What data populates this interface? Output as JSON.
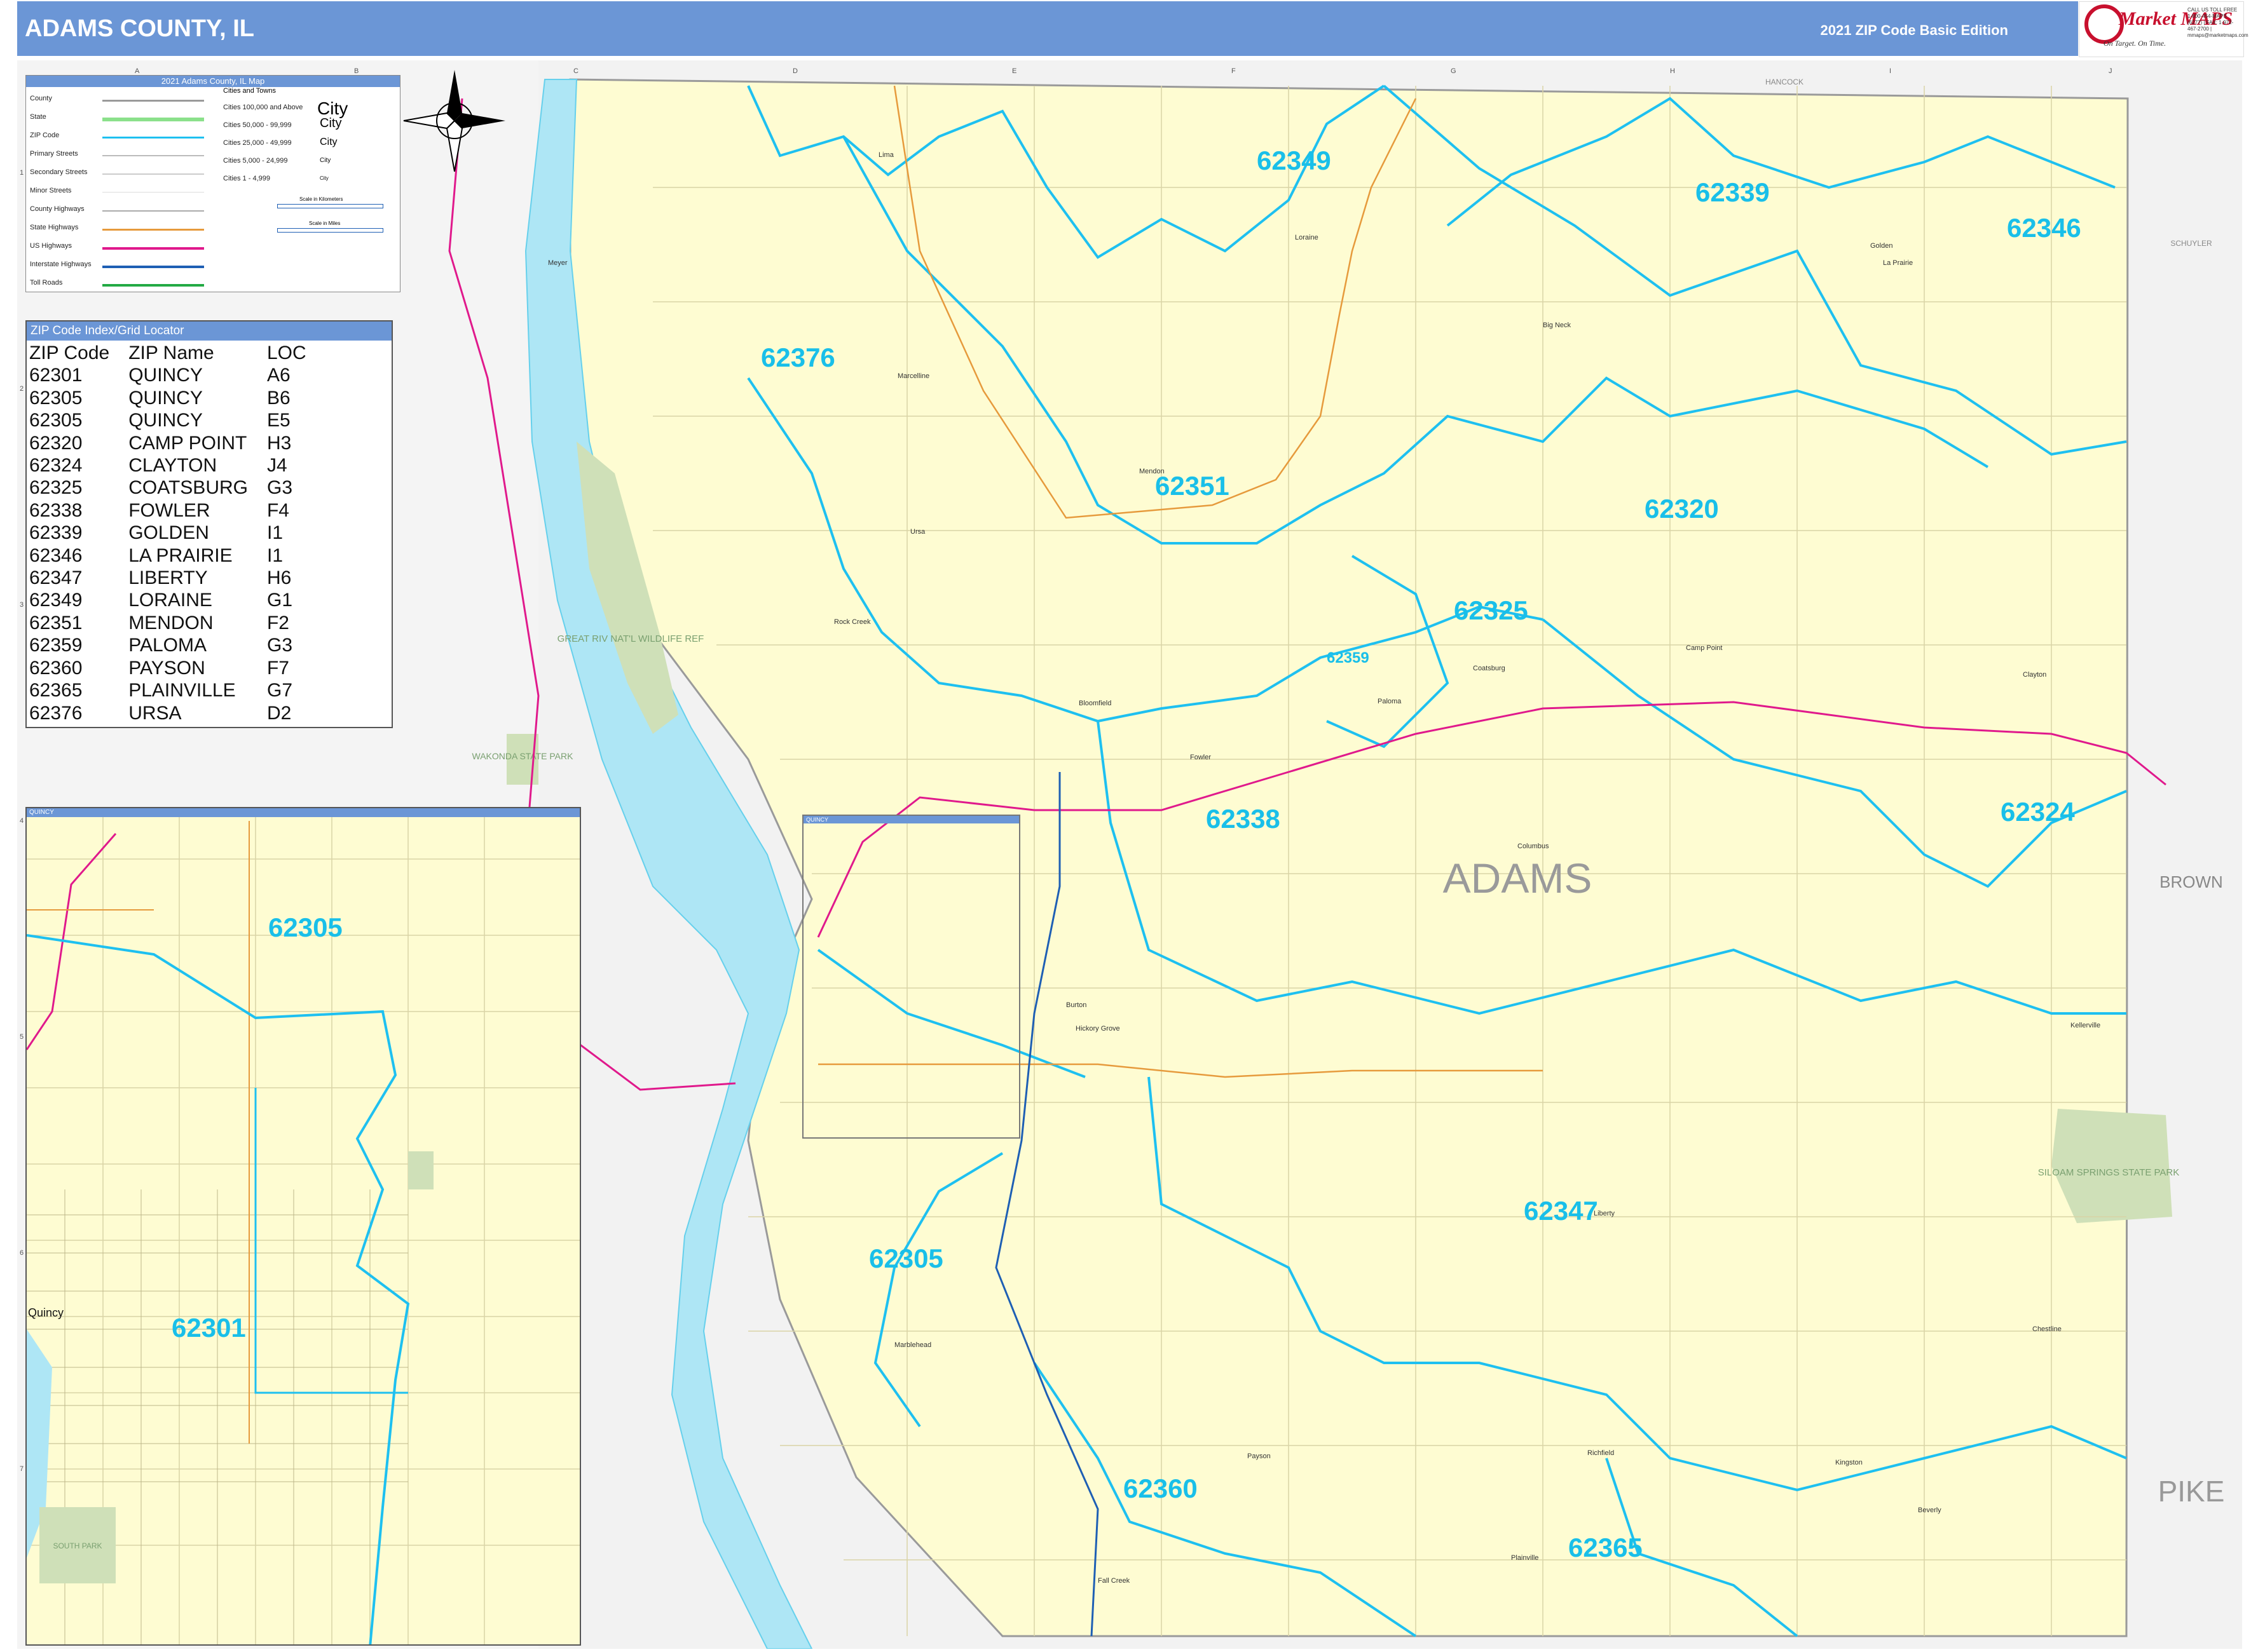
{
  "header": {
    "title": "ADAMS COUNTY, IL",
    "edition": "2021 ZIP Code Basic Edition"
  },
  "brand": {
    "name": "Market MAPS",
    "tagline": "On Target. On Time.",
    "subtitle": "America's Leading Source of Reference Maps",
    "contact": "CALL US TOLL FREE 1-800-454-MAPS (6277) | FAX: 1-972-467-2700 | mmaps@marketmaps.com"
  },
  "legend": {
    "title": "2021 Adams County, IL Map",
    "cities_heading": "Cities and Towns",
    "rows": [
      {
        "label": "County",
        "color": "#9a9a9a"
      },
      {
        "label": "State",
        "color": "#8be08b"
      },
      {
        "label": "ZIP Code",
        "color": "#1ec0f0"
      },
      {
        "label": "Primary Streets",
        "color": "#bbbbbb"
      },
      {
        "label": "Secondary Streets",
        "color": "#cccccc"
      },
      {
        "label": "Minor Streets",
        "color": "#dddddd"
      },
      {
        "label": "County Highways",
        "color": "#aaaaaa"
      },
      {
        "label": "State Highways",
        "color": "#e69a3c"
      },
      {
        "label": "US Highways",
        "color": "#e0198c"
      },
      {
        "label": "Interstate Highways",
        "color": "#1e5fb4"
      },
      {
        "label": "Toll Roads",
        "color": "#22aa44"
      }
    ],
    "city_classes": [
      {
        "label": "Cities 100,000 and Above",
        "sample": "City"
      },
      {
        "label": "Cities 50,000 - 99,999",
        "sample": "City"
      },
      {
        "label": "Cities 25,000 - 49,999",
        "sample": "City"
      },
      {
        "label": "Cities 5,000 - 24,999",
        "sample": "City"
      },
      {
        "label": "Cities 1 - 4,999",
        "sample": "City"
      }
    ],
    "scale_km": "Scale in Kilometers",
    "scale_mi": "Scale in Miles"
  },
  "zip_index": {
    "title": "ZIP Code Index/Grid Locator",
    "columns": [
      "ZIP Code",
      "ZIP Name",
      "LOC"
    ],
    "rows": [
      [
        "62301",
        "QUINCY",
        "A6"
      ],
      [
        "62305",
        "QUINCY",
        "B6"
      ],
      [
        "62305",
        "QUINCY",
        "E5"
      ],
      [
        "62320",
        "CAMP POINT",
        "H3"
      ],
      [
        "62324",
        "CLAYTON",
        "J4"
      ],
      [
        "62325",
        "COATSBURG",
        "G3"
      ],
      [
        "62338",
        "FOWLER",
        "F4"
      ],
      [
        "62339",
        "GOLDEN",
        "I1"
      ],
      [
        "62346",
        "LA PRAIRIE",
        "I1"
      ],
      [
        "62347",
        "LIBERTY",
        "H6"
      ],
      [
        "62349",
        "LORAINE",
        "G1"
      ],
      [
        "62351",
        "MENDON",
        "F2"
      ],
      [
        "62359",
        "PALOMA",
        "G3"
      ],
      [
        "62360",
        "PAYSON",
        "F7"
      ],
      [
        "62365",
        "PLAINVILLE",
        "G7"
      ],
      [
        "62376",
        "URSA",
        "D2"
      ]
    ]
  },
  "map": {
    "county_label": "ADAMS",
    "neighbors": [
      "BROWN",
      "PIKE",
      "HANCOCK",
      "SCHUYLER"
    ],
    "zip_labels": [
      "62349",
      "62339",
      "62346",
      "62376",
      "62351",
      "62320",
      "62325",
      "62359",
      "62338",
      "62324",
      "62305",
      "62347",
      "62360",
      "62365"
    ],
    "parks": [
      {
        "name": "GREAT RIV NAT'L WILDLIFE REF"
      },
      {
        "name": "WAKONDA STATE PARK"
      },
      {
        "name": "SILOAM SPRINGS STATE PARK"
      }
    ],
    "towns": [
      "Meyer",
      "Lima",
      "Ursa",
      "Loraine",
      "Golden",
      "La Prairie",
      "Mendon",
      "Coatsburg",
      "Camp Point",
      "Clayton",
      "Paloma",
      "Fowler",
      "Columbus",
      "Marcelline",
      "Rock Creek",
      "Bloomfield",
      "Kellerville",
      "Liberty",
      "Plainville",
      "Payson",
      "Fall Creek",
      "Richfield",
      "Kingston",
      "Beverly",
      "Chestline",
      "Marblehead",
      "Quincy",
      "Burton",
      "Hickory Grove",
      "Big Neck",
      "Siloam Springs"
    ],
    "grid_cols": [
      "A",
      "B",
      "C",
      "D",
      "E",
      "F",
      "G",
      "H",
      "I",
      "J"
    ],
    "grid_rows": [
      "1",
      "2",
      "3",
      "4",
      "5",
      "6",
      "7"
    ]
  },
  "inset": {
    "title": "QUINCY",
    "zip_labels": [
      "62305",
      "62301"
    ],
    "city": "Quincy",
    "park": "SOUTH PARK"
  },
  "colors": {
    "land": "#fefcd2",
    "water": "#aee6f5",
    "zip_line": "#1ec0f0",
    "us_highway": "#e0198c",
    "state_highway": "#e69a3c",
    "interstate": "#1e5fb4",
    "park": "#cfe0b8",
    "header": "#6b96d6"
  }
}
